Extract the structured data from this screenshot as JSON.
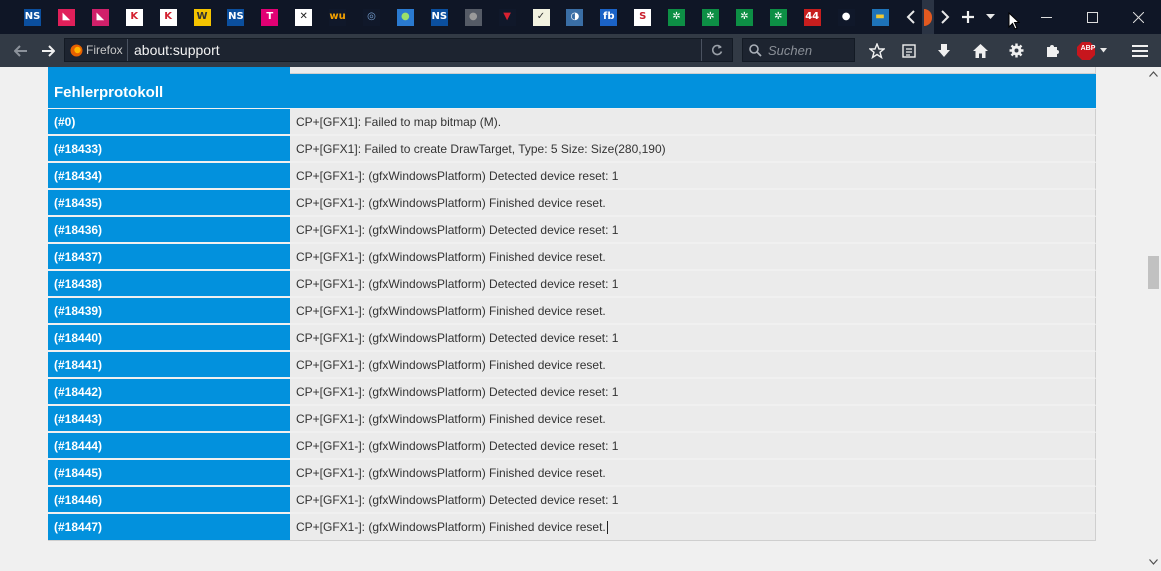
{
  "tabs": [
    {
      "name": "tab-1",
      "badge": "NS",
      "bg": "#0b4f9e",
      "fg": "#ffffff"
    },
    {
      "name": "tab-2",
      "badge": "◣",
      "bg": "#e0205a",
      "fg": "#ffffff"
    },
    {
      "name": "tab-3",
      "badge": "◣",
      "bg": "#d0206a",
      "fg": "#ffffff"
    },
    {
      "name": "tab-4",
      "badge": "K",
      "bg": "#ffffff",
      "fg": "#d32030"
    },
    {
      "name": "tab-5",
      "badge": "K",
      "bg": "#ffffff",
      "fg": "#d32030"
    },
    {
      "name": "tab-6",
      "badge": "W",
      "bg": "#f5c400",
      "fg": "#333333"
    },
    {
      "name": "tab-7",
      "badge": "NS",
      "bg": "#0b4f9e",
      "fg": "#ffffff"
    },
    {
      "name": "tab-8",
      "badge": "T",
      "bg": "#e20074",
      "fg": "#ffffff"
    },
    {
      "name": "tab-9",
      "badge": "✕",
      "bg": "#ffffff",
      "fg": "#222222"
    },
    {
      "name": "tab-10",
      "badge": "wu",
      "bg": "#10182a",
      "fg": "#f5a200"
    },
    {
      "name": "tab-11",
      "badge": "◎",
      "bg": "#10182a",
      "fg": "#7aa6d8"
    },
    {
      "name": "tab-12",
      "badge": "●",
      "bg": "#2a7ad0",
      "fg": "#9be06a"
    },
    {
      "name": "tab-13",
      "badge": "NS",
      "bg": "#0b4f9e",
      "fg": "#ffffff"
    },
    {
      "name": "tab-14",
      "badge": "●",
      "bg": "#555b66",
      "fg": "#9a9a9a"
    },
    {
      "name": "tab-15",
      "badge": "▼",
      "bg": "#10182a",
      "fg": "#d82030"
    },
    {
      "name": "tab-16",
      "badge": "✓",
      "bg": "#f2f2e0",
      "fg": "#333333"
    },
    {
      "name": "tab-17",
      "badge": "◑",
      "bg": "#3a6ea5",
      "fg": "#ffffff"
    },
    {
      "name": "tab-18",
      "badge": "fb",
      "bg": "#1b63c7",
      "fg": "#ffffff"
    },
    {
      "name": "tab-19",
      "badge": "S",
      "bg": "#ffffff",
      "fg": "#c81e2c"
    },
    {
      "name": "tab-20",
      "badge": "✲",
      "bg": "#0d8f45",
      "fg": "#ffffff"
    },
    {
      "name": "tab-21",
      "badge": "✲",
      "bg": "#0d8f45",
      "fg": "#ffffff"
    },
    {
      "name": "tab-22",
      "badge": "✲",
      "bg": "#0d8f45",
      "fg": "#ffffff"
    },
    {
      "name": "tab-23",
      "badge": "✲",
      "bg": "#0d8f45",
      "fg": "#ffffff"
    },
    {
      "name": "tab-24",
      "badge": "44",
      "bg": "#c81e1e",
      "fg": "#ffffff"
    },
    {
      "name": "tab-25",
      "badge": "●",
      "bg": "#10182a",
      "fg": "#ffffff"
    },
    {
      "name": "tab-26",
      "badge": "▬",
      "bg": "#1e73b8",
      "fg": "#f2c830"
    }
  ],
  "navbar": {
    "identity_label": "Firefox",
    "url": "about:support",
    "search_placeholder": "Suchen",
    "adblock_label": "ABP"
  },
  "error_log": {
    "title": "Fehlerprotokoll",
    "rows": [
      {
        "key": "(#0)",
        "value": "CP+[GFX1]: Failed to map bitmap (M)."
      },
      {
        "key": "(#18433)",
        "value": "CP+[GFX1]: Failed to create DrawTarget, Type: 5 Size: Size(280,190)"
      },
      {
        "key": "(#18434)",
        "value": "CP+[GFX1-]: (gfxWindowsPlatform) Detected device reset: 1"
      },
      {
        "key": "(#18435)",
        "value": "CP+[GFX1-]: (gfxWindowsPlatform) Finished device reset."
      },
      {
        "key": "(#18436)",
        "value": "CP+[GFX1-]: (gfxWindowsPlatform) Detected device reset: 1"
      },
      {
        "key": "(#18437)",
        "value": "CP+[GFX1-]: (gfxWindowsPlatform) Finished device reset."
      },
      {
        "key": "(#18438)",
        "value": "CP+[GFX1-]: (gfxWindowsPlatform) Detected device reset: 1"
      },
      {
        "key": "(#18439)",
        "value": "CP+[GFX1-]: (gfxWindowsPlatform) Finished device reset."
      },
      {
        "key": "(#18440)",
        "value": "CP+[GFX1-]: (gfxWindowsPlatform) Detected device reset: 1"
      },
      {
        "key": "(#18441)",
        "value": "CP+[GFX1-]: (gfxWindowsPlatform) Finished device reset."
      },
      {
        "key": "(#18442)",
        "value": "CP+[GFX1-]: (gfxWindowsPlatform) Detected device reset: 1"
      },
      {
        "key": "(#18443)",
        "value": "CP+[GFX1-]: (gfxWindowsPlatform) Finished device reset."
      },
      {
        "key": "(#18444)",
        "value": "CP+[GFX1-]: (gfxWindowsPlatform) Detected device reset: 1"
      },
      {
        "key": "(#18445)",
        "value": "CP+[GFX1-]: (gfxWindowsPlatform) Finished device reset."
      },
      {
        "key": "(#18446)",
        "value": "CP+[GFX1-]: (gfxWindowsPlatform) Detected device reset: 1"
      },
      {
        "key": "(#18447)",
        "value": "CP+[GFX1-]: (gfxWindowsPlatform) Finished device reset."
      }
    ]
  },
  "colors": {
    "tabstrip_bg": "#0f1626",
    "navbar_bg": "#323a45",
    "table_header_blue": "#0291dd",
    "cell_bg": "#ebebeb",
    "page_bg": "#f0f0f0"
  }
}
